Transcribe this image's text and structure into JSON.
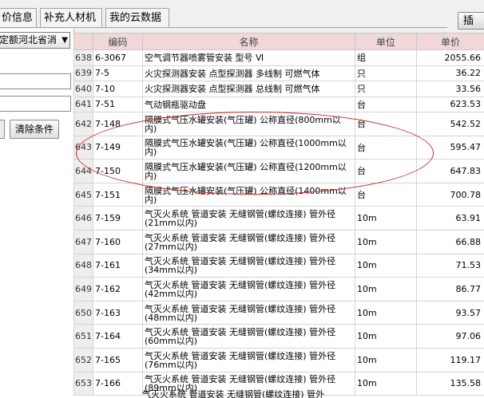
{
  "tabs": [
    {
      "label": "额价信息",
      "display": "价信息"
    },
    {
      "label": "补充人材机"
    },
    {
      "label": "我的云数据"
    }
  ],
  "insert_button": "插",
  "left_panel": {
    "quota_select": "定额河北省消",
    "clear_button": "清除条件"
  },
  "grid": {
    "columns": [
      "编码",
      "名称",
      "单位",
      "单价"
    ],
    "rows": [
      {
        "idx": "638",
        "code": "6-3067",
        "name": "空气调节器喷雾管安装 型号 Ⅵ",
        "unit": "组",
        "price": "2055.66"
      },
      {
        "idx": "639",
        "code": "7-5",
        "name": "火灾探测器安装 点型探测器 多线制 可燃气体",
        "unit": "只",
        "price": "36.22"
      },
      {
        "idx": "640",
        "code": "7-10",
        "name": "火灾探测器安装 点型探测器 总线制 可燃气体",
        "unit": "只",
        "price": "33.56"
      },
      {
        "idx": "641",
        "code": "7-51",
        "name": "气动钢瓶驱动盘",
        "unit": "台",
        "price": "623.53"
      },
      {
        "idx": "642",
        "code": "7-148",
        "name": "隔膜式气压水罐安装(气压罐) 公称直径(800mm以内)",
        "unit": "台",
        "price": "542.52"
      },
      {
        "idx": "643",
        "code": "7-149",
        "name": "隔膜式气压水罐安装(气压罐) 公称直径(1000mm以内)",
        "unit": "台",
        "price": "595.47"
      },
      {
        "idx": "644",
        "code": "7-150",
        "name": "隔膜式气压水罐安装(气压罐) 公称直径(1200mm以内)",
        "unit": "台",
        "price": "647.83"
      },
      {
        "idx": "645",
        "code": "7-151",
        "name": "隔膜式气压水罐安装(气压罐) 公称直径(1400mm以内)",
        "unit": "台",
        "price": "700.78"
      },
      {
        "idx": "646",
        "code": "7-159",
        "name": "气灭火系统 管道安装 无缝钢管(螺纹连接) 管外径(21mm以内)",
        "unit": "10m",
        "price": "63.91"
      },
      {
        "idx": "647",
        "code": "7-160",
        "name": "气灭火系统 管道安装 无缝钢管(螺纹连接) 管外径(27mm以内)",
        "unit": "10m",
        "price": "66.88"
      },
      {
        "idx": "648",
        "code": "7-161",
        "name": "气灭火系统 管道安装 无缝钢管(螺纹连接) 管外径(34mm以内)",
        "unit": "10m",
        "price": "71.53"
      },
      {
        "idx": "649",
        "code": "7-162",
        "name": "气灭火系统 管道安装 无缝钢管(螺纹连接) 管外径(42mm以内)",
        "unit": "10m",
        "price": "86.77"
      },
      {
        "idx": "650",
        "code": "7-163",
        "name": "气灭火系统 管道安装 无缝钢管(螺纹连接) 管外径(48mm以内)",
        "unit": "10m",
        "price": "93.57"
      },
      {
        "idx": "651",
        "code": "7-164",
        "name": "气灭火系统 管道安装 无缝钢管(螺纹连接) 管外径(60mm以内)",
        "unit": "10m",
        "price": "97.06"
      },
      {
        "idx": "652",
        "code": "7-165",
        "name": "气灭火系统 管道安装 无缝钢管(螺纹连接) 管外径(76mm以内)",
        "unit": "10m",
        "price": "119.17"
      },
      {
        "idx": "653",
        "code": "7-166",
        "name": "气灭火系统 管道安装 无缝钢管(螺纹连接) 管外径(89mm以内)",
        "unit": "10m",
        "price": "135.58"
      }
    ],
    "partial_row_name": "气灭火系统 管道安装 无缝钢管(螺纹连接) 管外"
  },
  "colors": {
    "header_bg": "#f0d8d8",
    "highlight_circle": "#d02828"
  }
}
